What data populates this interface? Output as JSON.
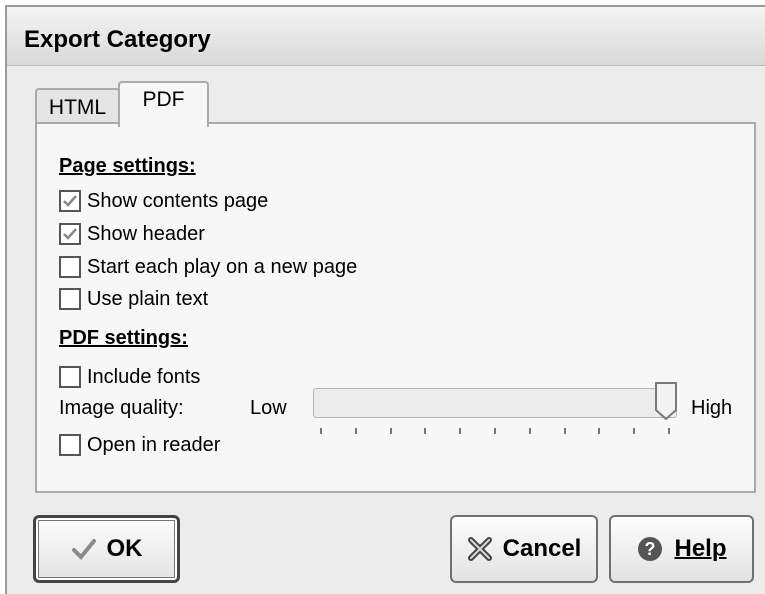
{
  "window": {
    "title": "Export Category"
  },
  "tabs": [
    {
      "label": "HTML",
      "active": false
    },
    {
      "label": "PDF",
      "active": true
    }
  ],
  "page_settings": {
    "heading": "Page settings:",
    "options": [
      {
        "label": "Show contents page",
        "checked": true
      },
      {
        "label": "Show header",
        "checked": true
      },
      {
        "label": "Start each play on a new page",
        "checked": false
      },
      {
        "label": "Use plain text",
        "checked": false
      }
    ]
  },
  "pdf_settings": {
    "heading": "PDF settings:",
    "include_fonts": {
      "label": "Include fonts",
      "checked": false
    },
    "image_quality": {
      "label": "Image quality:",
      "low_label": "Low",
      "high_label": "High",
      "value_fraction": 1.0
    },
    "open_in_reader": {
      "label": "Open in reader",
      "checked": false
    }
  },
  "buttons": {
    "ok": "OK",
    "cancel": "Cancel",
    "help": "Help"
  },
  "icons": {
    "ok": "checkmark-icon",
    "cancel": "x-cross-icon",
    "help": "question-icon"
  }
}
